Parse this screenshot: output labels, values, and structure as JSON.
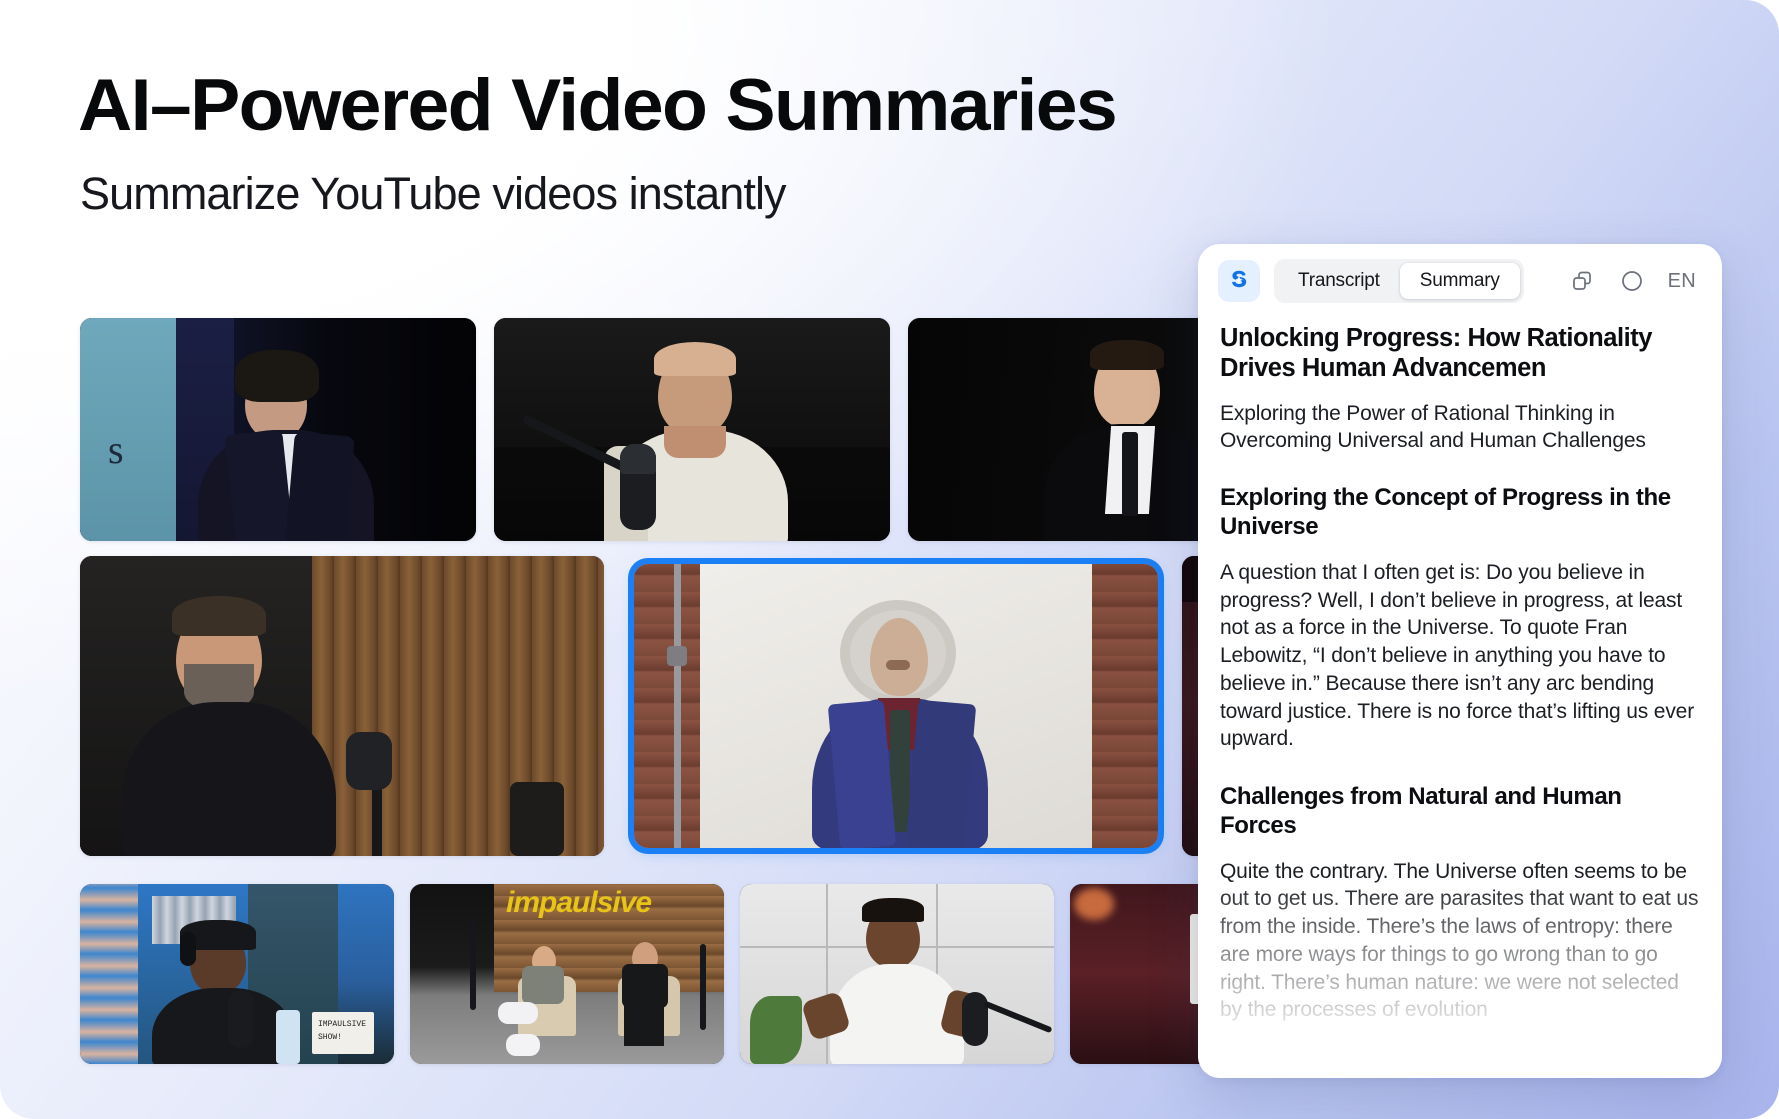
{
  "hero": {
    "title": "AI–Powered Video Summaries",
    "subtitle": "Summarize YouTube videos instantly"
  },
  "colors": {
    "accent_blue": "#1b80f5",
    "logo_blue": "#1273e6",
    "logo_tile_bg": "#e5f0ff",
    "panel_bg": "#ffffff",
    "segmented_bg": "#f1f2f4",
    "text_primary": "#0b0d10",
    "text_body": "#1b1e23",
    "icon_gray": "#6b7079",
    "bg_gradient_start": "#ffffff",
    "bg_gradient_end": "#a8b4ec"
  },
  "panel": {
    "logo_icon": "sparkle-s-logo-icon",
    "tabs": [
      {
        "label": "Transcript",
        "active": false
      },
      {
        "label": "Summary",
        "active": true
      }
    ],
    "actions": [
      {
        "name": "copy-icon",
        "label": ""
      },
      {
        "name": "progress-circle-icon",
        "label": ""
      },
      {
        "name": "language-selector",
        "label": "EN"
      }
    ],
    "summary": {
      "title": "Unlocking Progress: How Rationality Drives Human Advancemen",
      "subtitle": "Exploring the Power of Rational Thinking in Overcoming Universal and Human Challenges",
      "sections": [
        {
          "heading": "Exploring the Concept of Progress in the Universe",
          "body": "A question that I often get is: Do you believe in progress? Well, I don’t believe in progress, at least not as a force in the Universe. To quote Fran Lebowitz, “I don’t believe in anything you have to believe in.” Because there isn’t any arc bending toward justice. There is no force that’s lifting us ever upward."
        },
        {
          "heading": "Challenges from Natural and Human Forces",
          "body": "Quite the contrary. The Universe often seems to be out to get us. There are parasites that want to eat us from the inside. There’s the laws of entropy: there are more ways for things to go wrong than to go right. There’s human nature: we were not selected by the processes of evolution"
        }
      ]
    }
  },
  "thumbnails": [
    {
      "id": "thumb-1",
      "alt": "Speaker in dark suit on stage with blue screen",
      "selected": false
    },
    {
      "id": "thumb-2",
      "alt": "Bald man in white t-shirt at podcast microphone",
      "selected": false
    },
    {
      "id": "thumb-3",
      "alt": "Man in black suit and tie at podcast microphone",
      "selected": false
    },
    {
      "id": "thumb-4",
      "alt": "Bearded man in black shirt with wood slat wall",
      "selected": false
    },
    {
      "id": "thumb-5",
      "alt": "Grey haired man in blue suit against white backdrop",
      "selected": true
    },
    {
      "id": "thumb-6",
      "alt": "Podcast studio with red lighting",
      "selected": false
    },
    {
      "id": "thumb-7",
      "alt": "Man with headphones in blue studio, Impaulsive Show sign",
      "selected": false
    },
    {
      "id": "thumb-8",
      "alt": "Two men seated in chairs under Impaulsive sign",
      "selected": false
    },
    {
      "id": "thumb-9",
      "alt": "Man in white shirt gesturing near microphone",
      "selected": false
    },
    {
      "id": "thumb-10",
      "alt": "Studio with whiteboard and red wall",
      "selected": false
    }
  ]
}
